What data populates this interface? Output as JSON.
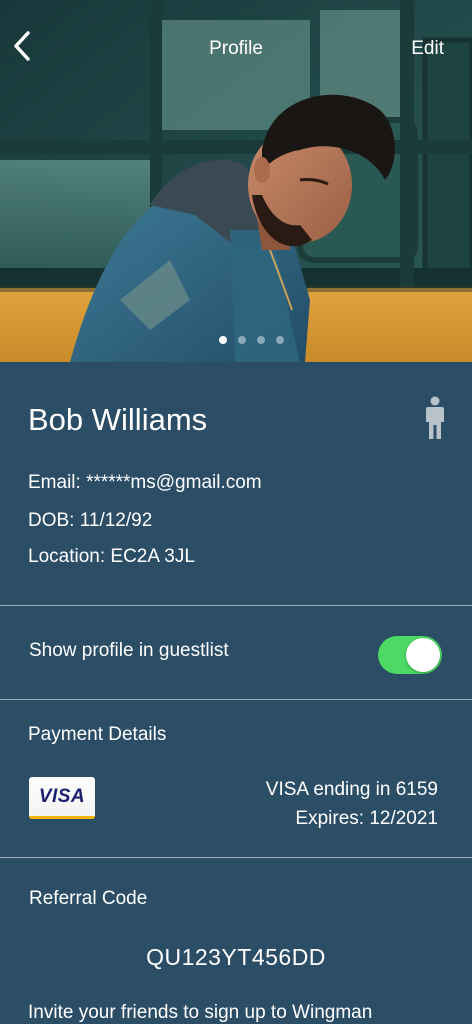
{
  "header": {
    "title": "Profile",
    "edit_label": "Edit",
    "back_icon": "chevron-left-icon"
  },
  "gallery": {
    "photo_count": 4,
    "active_index": 0
  },
  "profile": {
    "name": "Bob Williams",
    "gender_icon": "male-person-icon",
    "email": "Email: ******ms@gmail.com",
    "dob": "DOB: 11/12/92",
    "location": "Location: EC2A 3JL"
  },
  "guestlist": {
    "label": "Show profile in guestlist",
    "enabled": true,
    "toggle_color": "#4cd964"
  },
  "payment": {
    "title": "Payment Details",
    "card_brand": "VISA",
    "card_line": "VISA ending in 6159",
    "expiry_line": "Expires: 12/2021"
  },
  "referral": {
    "title": "Referral Code",
    "code": "QU123YT456DD",
    "invite_text": "Invite your friends to sign up to Wingman"
  },
  "colors": {
    "background": "#2b4d66",
    "divider": "#ffffff"
  }
}
